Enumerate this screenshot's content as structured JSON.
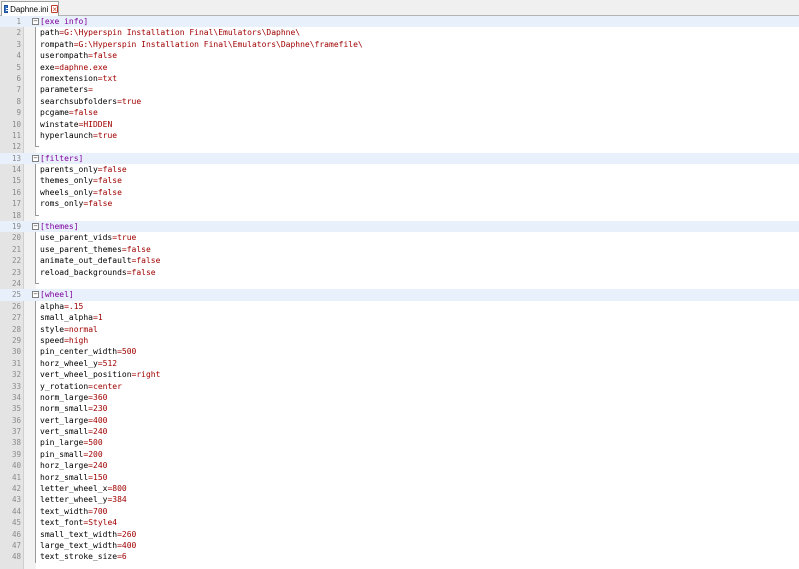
{
  "tab": {
    "label": "Daphne.ini",
    "close_label": "×"
  },
  "fold_glyph": "−",
  "colors": {
    "section": "#8000a0",
    "value": "#a00000",
    "key": "#000000"
  },
  "lines": [
    {
      "n": "1",
      "section": "[exe info]"
    },
    {
      "n": "2",
      "key": "path",
      "val": "G:\\Hyperspin Installation Final\\Emulators\\Daphne\\"
    },
    {
      "n": "3",
      "key": "rompath",
      "val": "G:\\Hyperspin Installation Final\\Emulators\\Daphne\\framefile\\"
    },
    {
      "n": "4",
      "key": "userompath",
      "val": "false"
    },
    {
      "n": "5",
      "key": "exe",
      "val": "daphne.exe"
    },
    {
      "n": "6",
      "key": "romextension",
      "val": "txt"
    },
    {
      "n": "7",
      "key": "parameters",
      "val": ""
    },
    {
      "n": "8",
      "key": "searchsubfolders",
      "val": "true"
    },
    {
      "n": "9",
      "key": "pcgame",
      "val": "false"
    },
    {
      "n": "10",
      "key": "winstate",
      "val": "HIDDEN"
    },
    {
      "n": "11",
      "key": "hyperlaunch",
      "val": "true"
    },
    {
      "n": "12",
      "blank": true
    },
    {
      "n": "13",
      "section": "[filters]"
    },
    {
      "n": "14",
      "key": "parents_only",
      "val": "false"
    },
    {
      "n": "15",
      "key": "themes_only",
      "val": "false"
    },
    {
      "n": "16",
      "key": "wheels_only",
      "val": "false"
    },
    {
      "n": "17",
      "key": "roms_only",
      "val": "false"
    },
    {
      "n": "18",
      "blank": true
    },
    {
      "n": "19",
      "section": "[themes]"
    },
    {
      "n": "20",
      "key": "use_parent_vids",
      "val": "true"
    },
    {
      "n": "21",
      "key": "use_parent_themes",
      "val": "false"
    },
    {
      "n": "22",
      "key": "animate_out_default",
      "val": "false"
    },
    {
      "n": "23",
      "key": "reload_backgrounds",
      "val": "false"
    },
    {
      "n": "24",
      "blank": true
    },
    {
      "n": "25",
      "section": "[wheel]"
    },
    {
      "n": "26",
      "key": "alpha",
      "val": ".15"
    },
    {
      "n": "27",
      "key": "small_alpha",
      "val": "1"
    },
    {
      "n": "28",
      "key": "style",
      "val": "normal"
    },
    {
      "n": "29",
      "key": "speed",
      "val": "high"
    },
    {
      "n": "30",
      "key": "pin_center_width",
      "val": "500"
    },
    {
      "n": "31",
      "key": "horz_wheel_y",
      "val": "512"
    },
    {
      "n": "32",
      "key": "vert_wheel_position",
      "val": "right"
    },
    {
      "n": "33",
      "key": "y_rotation",
      "val": "center"
    },
    {
      "n": "34",
      "key": "norm_large",
      "val": "360"
    },
    {
      "n": "35",
      "key": "norm_small",
      "val": "230"
    },
    {
      "n": "36",
      "key": "vert_large",
      "val": "400"
    },
    {
      "n": "37",
      "key": "vert_small",
      "val": "240"
    },
    {
      "n": "38",
      "key": "pin_large",
      "val": "500"
    },
    {
      "n": "39",
      "key": "pin_small",
      "val": "200"
    },
    {
      "n": "40",
      "key": "horz_large",
      "val": "240"
    },
    {
      "n": "41",
      "key": "horz_small",
      "val": "150"
    },
    {
      "n": "42",
      "key": "letter_wheel_x",
      "val": "800"
    },
    {
      "n": "43",
      "key": "letter_wheel_y",
      "val": "384"
    },
    {
      "n": "44",
      "key": "text_width",
      "val": "700"
    },
    {
      "n": "45",
      "key": "text_font",
      "val": "Style4"
    },
    {
      "n": "46",
      "key": "small_text_width",
      "val": "260"
    },
    {
      "n": "47",
      "key": "large_text_width",
      "val": "400"
    },
    {
      "n": "48",
      "key": "text_stroke_size",
      "val": "6"
    }
  ]
}
